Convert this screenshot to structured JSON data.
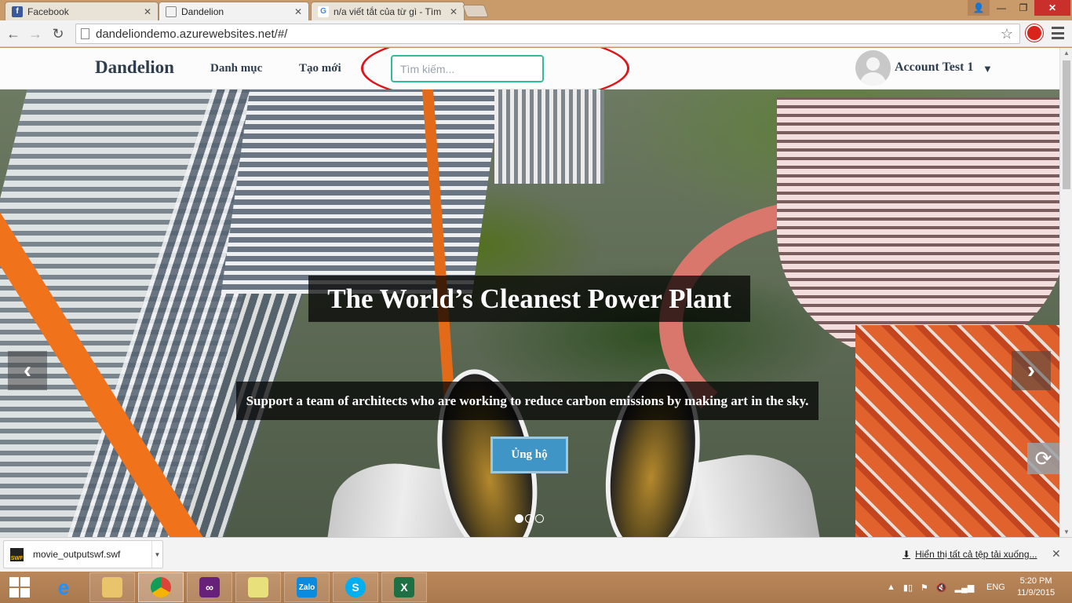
{
  "browser": {
    "tabs": [
      {
        "label": "Facebook",
        "favicon": "facebook-icon",
        "color": "#3b5998"
      },
      {
        "label": "Dandelion",
        "favicon": "page-icon",
        "color": "#888888"
      },
      {
        "label": "n/a viết tắt của từ gì - Tìm",
        "favicon": "google-icon",
        "color": "#4285f4"
      }
    ],
    "url": "dandeliondemo.azurewebsites.net/#/"
  },
  "site": {
    "brand": "Dandelion",
    "nav": {
      "categories": "Danh mục",
      "create": "Tạo mới"
    },
    "search": {
      "placeholder": "Tìm kiếm...",
      "value": ""
    },
    "account": {
      "name": "Account Test 1"
    },
    "annotation_color": "#e0151c",
    "accent": "#2ebd9a"
  },
  "hero": {
    "title": "The World’s Cleanest Power Plant",
    "subtitle": "Support a team of architects who are working to reduce carbon emissions by making art in the sky.",
    "button": "Ủng hộ",
    "button_color": "#3f96c6",
    "slides": 3,
    "active_slide": 1
  },
  "downloads": {
    "item": "movie_outputswf.swf",
    "show_all": "Hiển thị tất cả tệp tải xuống..."
  },
  "taskbar": {
    "apps": [
      "start",
      "internet-explorer",
      "file-explorer",
      "chrome",
      "visual-studio",
      "sticky-notes",
      "zalo",
      "skype",
      "excel"
    ],
    "language": "ENG",
    "time": "5:20 PM",
    "date": "11/9/2015"
  }
}
